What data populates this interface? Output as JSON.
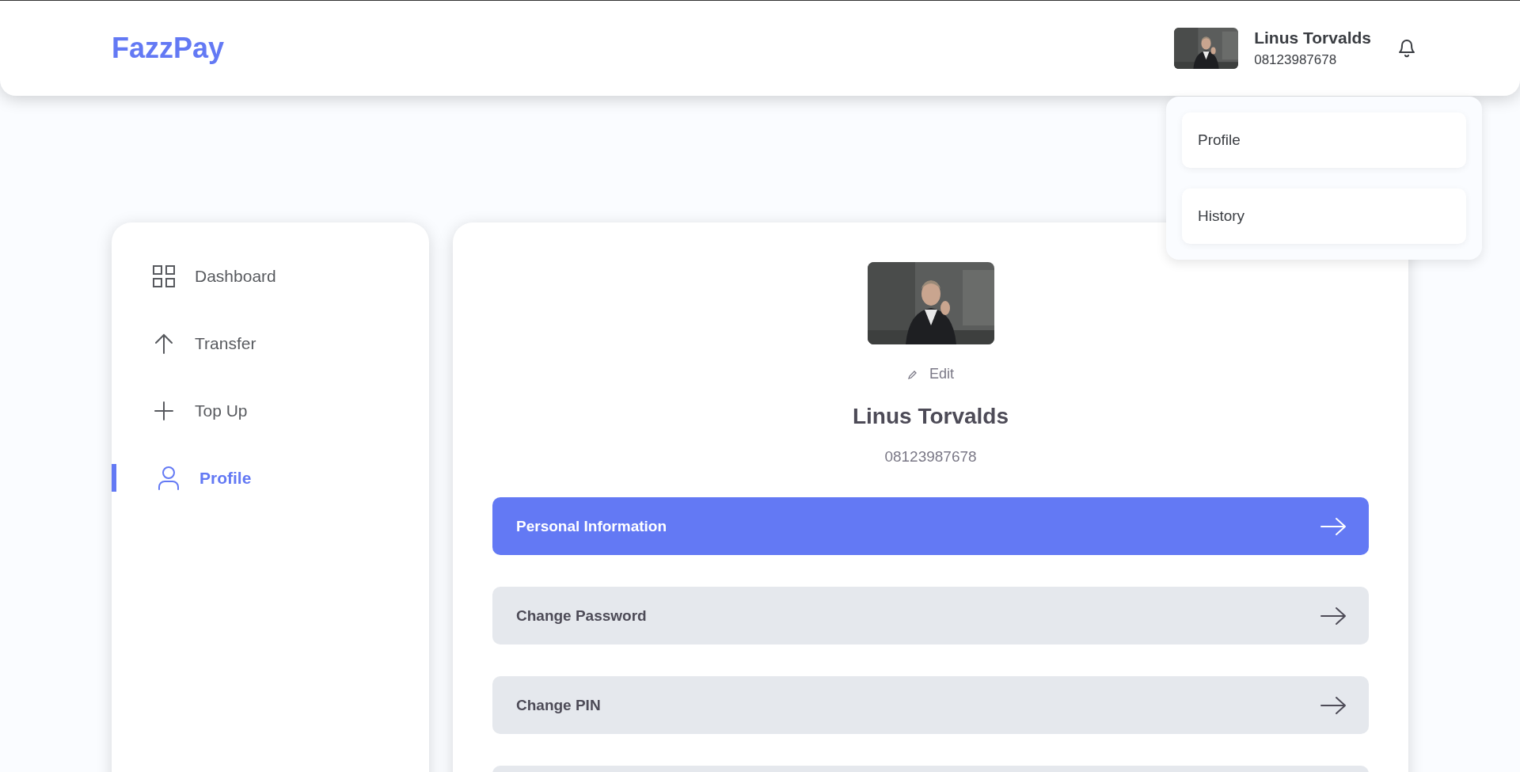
{
  "header": {
    "logo": "FazzPay",
    "user": {
      "name": "Linus Torvalds",
      "phone": "08123987678"
    },
    "notifications": {
      "unread": false
    }
  },
  "dropdown": {
    "items": [
      {
        "label": "Profile"
      },
      {
        "label": "History"
      }
    ]
  },
  "sidebar": {
    "items": [
      {
        "label": "Dashboard",
        "kind": "grid",
        "selected": false
      },
      {
        "label": "Transfer",
        "kind": "arrow-up",
        "selected": false
      },
      {
        "label": "Top Up",
        "kind": "plus",
        "selected": false
      },
      {
        "label": "Profile",
        "kind": "user",
        "selected": true
      }
    ]
  },
  "profile": {
    "edit_label": "Edit",
    "name": "Linus Torvalds",
    "phone": "08123987678",
    "menu": [
      {
        "label": "Personal Information",
        "selected": true
      },
      {
        "label": "Change Password",
        "selected": false
      },
      {
        "label": "Change PIN",
        "selected": false
      },
      {
        "selected": false
      }
    ]
  }
}
